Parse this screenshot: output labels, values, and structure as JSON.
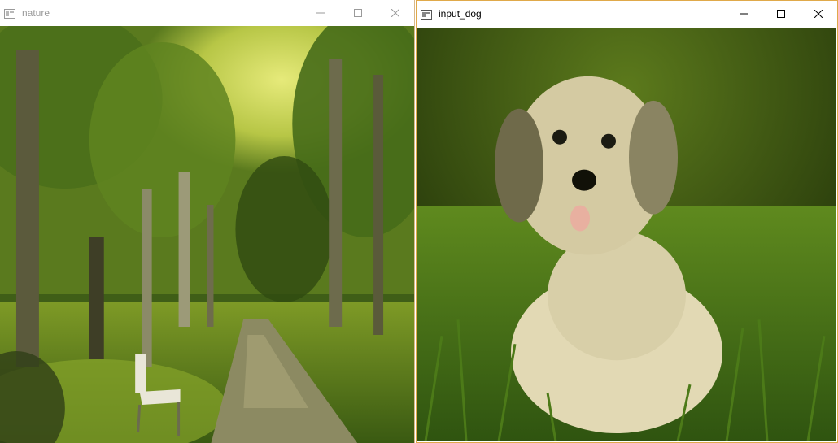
{
  "windows": [
    {
      "title": "nature",
      "icon": "window-app-icon",
      "controls": [
        "minimize-icon",
        "maximize-icon",
        "close-icon"
      ],
      "image": "forest path with bench"
    },
    {
      "title": "input_dog",
      "icon": "window-app-icon",
      "controls": [
        "minimize-icon",
        "maximize-icon",
        "close-icon"
      ],
      "image": "dog sitting in grass"
    }
  ],
  "colors": {
    "inactive_title": "#9a9a9a",
    "active_title": "#000000",
    "active_border": "#e0a94a"
  }
}
